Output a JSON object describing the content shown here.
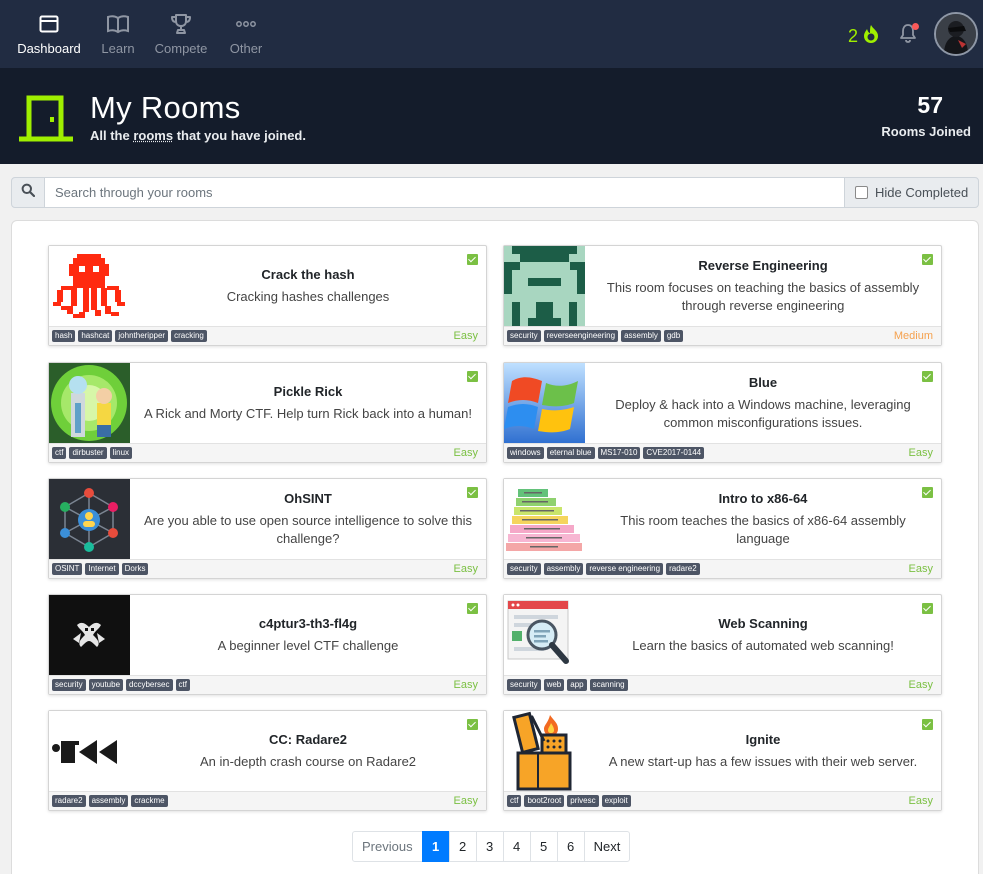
{
  "nav": {
    "items": [
      {
        "label": "Dashboard",
        "icon": "dashboard-icon"
      },
      {
        "label": "Learn",
        "icon": "book-icon"
      },
      {
        "label": "Compete",
        "icon": "trophy-icon"
      },
      {
        "label": "Other",
        "icon": "more-icon"
      }
    ],
    "streak": "2",
    "colors": {
      "nav_bg": "#212c42",
      "accent": "#9fef00",
      "notification_dot": "#f95959"
    }
  },
  "header": {
    "title": "My Rooms",
    "subtitle_pre": "All the ",
    "subtitle_link": "rooms",
    "subtitle_post": " that you have joined.",
    "joined_count": "57",
    "joined_label": "Rooms Joined"
  },
  "search": {
    "placeholder": "Search through your rooms",
    "value": "",
    "hide_completed_label": "Hide Completed"
  },
  "rooms": [
    {
      "title": "Crack the hash",
      "description": "Cracking hashes challenges",
      "tags": [
        "hash",
        "hashcat",
        "johntheripper",
        "cracking"
      ],
      "difficulty": "Easy",
      "icon": "octopus-icon"
    },
    {
      "title": "Reverse Engineering",
      "description": "This room focuses on teaching the basics of assembly through reverse engineering",
      "tags": [
        "security",
        "reverseengineering",
        "assembly",
        "gdb"
      ],
      "difficulty": "Medium",
      "icon": "space-invader-icon"
    },
    {
      "title": "Pickle Rick",
      "description": "A Rick and Morty CTF. Help turn Rick back into a human!",
      "tags": [
        "ctf",
        "dirbuster",
        "linux"
      ],
      "difficulty": "Easy",
      "icon": "rick-morty-portal-icon"
    },
    {
      "title": "Blue",
      "description": "Deploy & hack into a Windows machine, leveraging common misconfigurations issues.",
      "tags": [
        "windows",
        "eternal blue",
        "MS17-010",
        "CVE2017-0144"
      ],
      "difficulty": "Easy",
      "icon": "windows-logo-icon"
    },
    {
      "title": "OhSINT",
      "description": "Are you able to use open source intelligence to solve this challenge?",
      "tags": [
        "OSINT",
        "Internet",
        "Dorks"
      ],
      "difficulty": "Easy",
      "icon": "network-graph-icon"
    },
    {
      "title": "Intro to x86-64",
      "description": "This room teaches the basics of x86-64 assembly language",
      "tags": [
        "security",
        "assembly",
        "reverse engineering",
        "radare2"
      ],
      "difficulty": "Easy",
      "icon": "language-stack-icon"
    },
    {
      "title": "c4ptur3-th3-fl4g",
      "description": "A beginner level CTF challenge",
      "tags": [
        "security",
        "youtube",
        "dccybersec",
        "ctf"
      ],
      "difficulty": "Easy",
      "icon": "mask-icon"
    },
    {
      "title": "Web Scanning",
      "description": "Learn the basics of automated web scanning!",
      "tags": [
        "security",
        "web",
        "app",
        "scanning"
      ],
      "difficulty": "Easy",
      "icon": "magnifier-browser-icon"
    },
    {
      "title": "CC: Radare2",
      "description": "An in-depth crash course on Radare2",
      "tags": [
        "radare2",
        "assembly",
        "crackme"
      ],
      "difficulty": "Easy",
      "icon": "radare2-logo-icon"
    },
    {
      "title": "Ignite",
      "description": "A new start-up has a few issues with their web server.",
      "tags": [
        "ctf",
        "boot2root",
        "privesc",
        "exploit"
      ],
      "difficulty": "Easy",
      "icon": "lighter-icon"
    }
  ],
  "pagination": {
    "previous": "Previous",
    "pages": [
      "1",
      "2",
      "3",
      "4",
      "5",
      "6"
    ],
    "current": "1",
    "next": "Next"
  }
}
